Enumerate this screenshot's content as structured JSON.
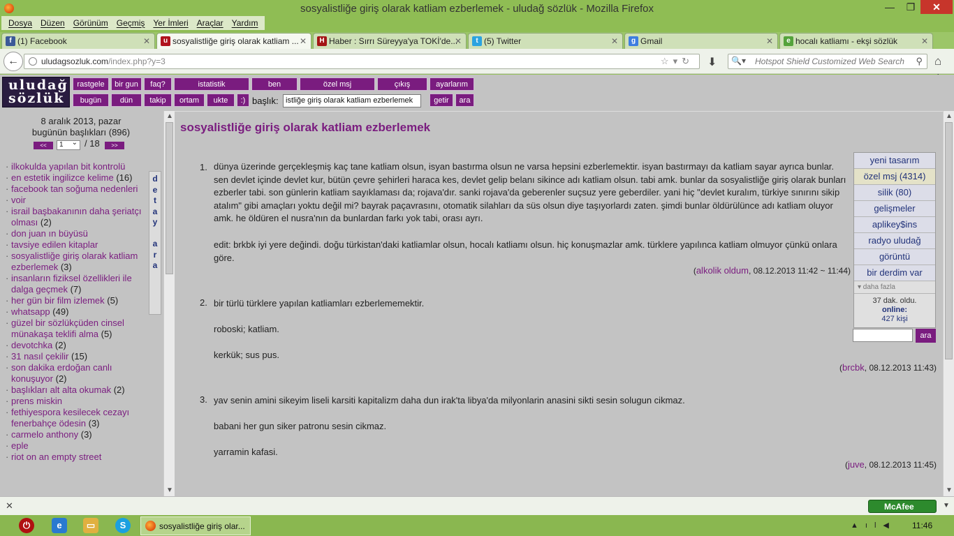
{
  "window": {
    "title": "sosyalistliğe giriş olarak katliam ezberlemek - uludağ sözlük - Mozilla Firefox",
    "minimize": "—",
    "restore": "❐",
    "close": "✕"
  },
  "menu": [
    "Dosya",
    "Düzen",
    "Görünüm",
    "Geçmiş",
    "Yer İmleri",
    "Araçlar",
    "Yardım"
  ],
  "tabs": [
    {
      "label": "(1) Facebook",
      "icon": "f",
      "color": "#3b5998"
    },
    {
      "label": "sosyalistliğe giriş olarak katliam ...",
      "icon": "u",
      "color": "#b0121d"
    },
    {
      "label": "Haber : Sırrı Süreyya'ya TOKİ'de...",
      "icon": "H",
      "color": "#a31515"
    },
    {
      "label": "(5) Twitter",
      "icon": "t",
      "color": "#2ba3e0"
    },
    {
      "label": "Gmail",
      "icon": "g",
      "color": "#3d7de0"
    },
    {
      "label": "hocalı katliamı - ekşi sözlük",
      "icon": "e",
      "color": "#54a33b"
    }
  ],
  "nav": {
    "url_host": "uludagsozluk.com",
    "url_path": "/index.php?y=3",
    "search_placeholder": "Hotspot Shield Customized Web Search"
  },
  "site": {
    "logo": "uludağ sözlük",
    "top_row1": [
      "rastgele",
      "bir gun",
      "faq?",
      "istatistik",
      "ben",
      "özel msj",
      "çıkış",
      "ayarlarım"
    ],
    "top_row2": [
      "bugün",
      "dün",
      "takip",
      "ortam",
      "ukte",
      ":)"
    ],
    "baslik_label": "başlık:",
    "baslik_value": "istliğe giriş olarak katliam ezberlemek",
    "getir": "getir",
    "ara": "ara"
  },
  "left": {
    "date": "8 aralık 2013, pazar",
    "count_label": "bugünün başlıkları (896)",
    "prev": "<<",
    "next": ">>",
    "page": "1",
    "total": "/ 18",
    "detay": "d e t a y a r a",
    "topics": [
      {
        "t": "ilkokulda yapılan bit kontrolü",
        "c": ""
      },
      {
        "t": "en estetik ingilizce kelime",
        "c": "(16)"
      },
      {
        "t": "facebook tan soğuma nedenleri",
        "c": ""
      },
      {
        "t": "voir",
        "c": ""
      },
      {
        "t": "israil başbakanının daha şeriatçı olması",
        "c": "(2)"
      },
      {
        "t": "don juan ın büyüsü",
        "c": ""
      },
      {
        "t": "tavsiye edilen kitaplar",
        "c": ""
      },
      {
        "t": "sosyalistliğe giriş olarak katliam ezberlemek",
        "c": "(3)"
      },
      {
        "t": "insanların fiziksel özellikleri ile dalga geçmek",
        "c": "(7)"
      },
      {
        "t": "her gün bir film izlemek",
        "c": "(5)"
      },
      {
        "t": "whatsapp",
        "c": "(49)"
      },
      {
        "t": "güzel bir sözlükçüden cinsel münakaşa teklifi alma",
        "c": "(5)"
      },
      {
        "t": "devotchka",
        "c": "(2)"
      },
      {
        "t": "31 nasıl çekilir",
        "c": "(15)"
      },
      {
        "t": "son dakika erdoğan canlı konuşuyor",
        "c": "(2)"
      },
      {
        "t": "başlıkları alt alta okumak",
        "c": "(2)"
      },
      {
        "t": "prens miskin",
        "c": ""
      },
      {
        "t": "fethiyespora kesilecek cezayı fenerbahçe ödesin",
        "c": "(3)"
      },
      {
        "t": "carmelo anthony",
        "c": "(3)"
      },
      {
        "t": "eple",
        "c": ""
      },
      {
        "t": "riot on an empty street",
        "c": ""
      }
    ]
  },
  "main": {
    "title": "sosyalistliğe giriş olarak katliam ezberlemek",
    "entries": [
      {
        "num": "1.",
        "p1": "dünya üzerinde gerçekleşmiş kaç tane katliam olsun, isyan bastırma olsun ne varsa hepsini ezberlemektir. isyan bastırmayı da katliam sayar ayrıca bunlar. sen devlet içinde devlet kur, bütün çevre şehirleri haraca kes, devlet gelip belanı sikince adı katliam olsun. tabi amk. bunlar da sosyalistliğe giriş olarak bunları ezberler tabi. son günlerin katliam sayıklaması da; rojava'dır. sanki rojava'da geberenler suçsuz yere geberdiler. yani hiç \"devlet kuralım, türkiye sınırını sikip atalım\" gibi amaçları yoktu değil mi? bayrak paçavrasını, otomatik silahları da süs olsun diye taşıyorlardı zaten. şimdi bunlar öldürülünce adı katliam oluyor amk. he öldüren el nusra'nın da bunlardan farkı yok tabi, orası ayrı.",
        "p2": "edit: brkbk iyi yere değindi. doğu türkistan'daki katliamlar olsun, hocalı katliamı olsun. hiç konuşmazlar amk. türklere yapılınca katliam olmuyor çünkü onlara göre.",
        "author": "alkolik oldum",
        "date": ", 08.12.2013 11:42 ~ 11:44)"
      },
      {
        "num": "2.",
        "p1": "bir türlü türklere yapılan katliamları ezberlememektir.",
        "p2": "roboski; katliam.",
        "p3": "kerkük; sus pus.",
        "author": "brcbk",
        "date": ", 08.12.2013 11:43)"
      },
      {
        "num": "3.",
        "p1": "yav senin amini sikeyim liseli karsiti kapitalizm daha dun irak'ta libya'da milyonlarin anasini sikti sesin solugun cikmaz.",
        "p2": "babani her gun siker patronu sesin cikmaz.",
        "p3": "yarramin kafasi.",
        "author": "juve",
        "date": ", 08.12.2013 11:45)"
      }
    ]
  },
  "side": {
    "items": [
      "yeni tasarım",
      "özel msj (4314)",
      "silik (80)",
      "gelişmeler",
      "aplikey$ins",
      "radyo uludağ",
      "görüntü",
      "bir derdim var"
    ],
    "more": "▾ daha fazla",
    "ago": "37 dak. oldu.",
    "online": "online:",
    "people": "427 kişi",
    "ara": "ara"
  },
  "status": {
    "close": "✕",
    "mcafee": "McAfee"
  },
  "taskbar": {
    "window": "sosyalistliğe giriş olar...",
    "time": "11:46"
  },
  "colors": {
    "accent": "#7a1c7f",
    "link": "#22337a",
    "bg": "#c3c3c3"
  }
}
